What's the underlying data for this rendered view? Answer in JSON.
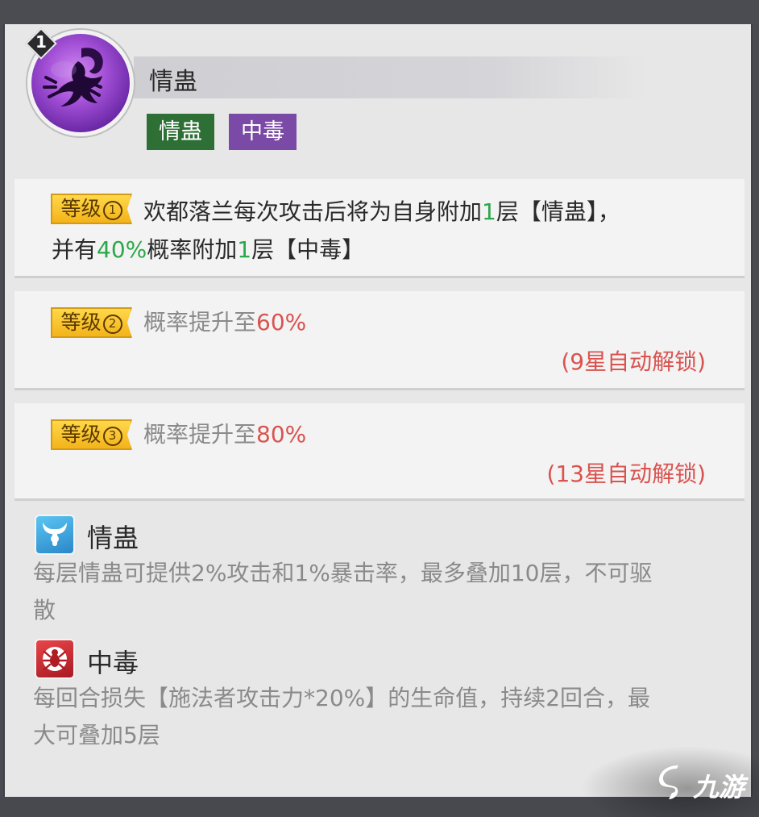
{
  "skill": {
    "level_number": "1",
    "icon": "scorpion-icon",
    "name": "情蛊",
    "tags": [
      {
        "label": "情蛊",
        "color": "#2e6f35"
      },
      {
        "label": "中毒",
        "color": "#7a4aa6"
      }
    ]
  },
  "levels": [
    {
      "badge": "等级",
      "badge_num": "1",
      "text_parts": [
        "欢都落兰每次攻击后将为自身附加",
        "1",
        "层【情蛊】，"
      ],
      "text_line2": [
        "并有",
        "40%",
        "概率附加",
        "1",
        "层【中毒】"
      ]
    },
    {
      "badge": "等级",
      "badge_num": "2",
      "text": "概率提升至",
      "value": "60%",
      "unlock": "(9星自动解锁)"
    },
    {
      "badge": "等级",
      "badge_num": "3",
      "text": "概率提升至",
      "value": "80%",
      "unlock": "(13星自动解锁)"
    }
  ],
  "effects": [
    {
      "icon": "bull-horns-icon",
      "title": "情蛊",
      "desc_line1": "每层情蛊可提供2%攻击和1%暴击率，最多叠加10层，不可驱",
      "desc_line2": "散"
    },
    {
      "icon": "spider-icon",
      "title": "中毒",
      "desc_line1": "每回合损失【施法者攻击力*20%】的生命值，持续2回合，最",
      "desc_line2": "大可叠加5层"
    }
  ],
  "watermark": {
    "text": "九游"
  },
  "colors": {
    "highlight_green": "#2aa84a",
    "highlight_red": "#d9534f",
    "level_badge": "#f3b31a"
  }
}
